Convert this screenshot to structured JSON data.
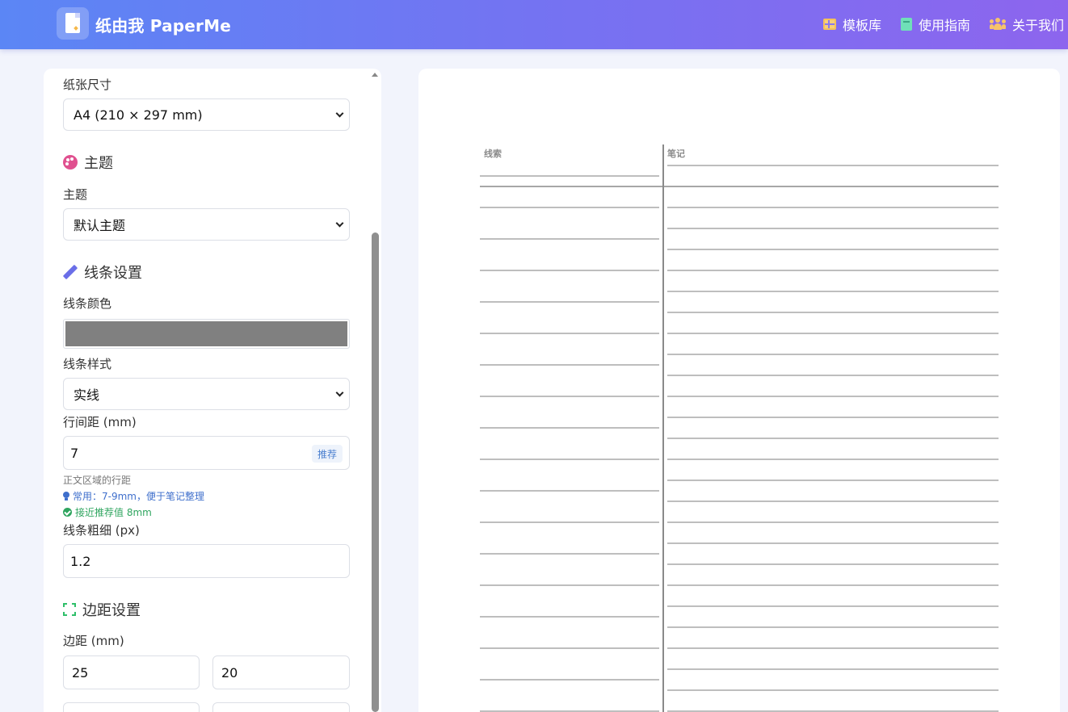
{
  "header": {
    "brand": "纸由我 PaperMe",
    "nav": {
      "templates": "模板库",
      "guide": "使用指南",
      "about": "关于我们"
    }
  },
  "sidebar": {
    "paper_size": {
      "label": "纸张尺寸",
      "value": "A4 (210 × 297 mm)"
    },
    "theme_section": {
      "title": "主题",
      "label": "主题",
      "value": "默认主题"
    },
    "line_section": {
      "title": "线条设置",
      "color_label": "线条颜色",
      "color_value": "#808080",
      "style_label": "线条样式",
      "style_value": "实线",
      "spacing_label": "行间距 (mm)",
      "spacing_value": "7",
      "spacing_badge": "推荐",
      "hint_region": "正文区域的行距",
      "hint_common": "常用：7-9mm，便于笔记整理",
      "hint_near": "接近推荐值 8mm",
      "width_label": "线条粗细 (px)",
      "width_value": "1.2"
    },
    "margin_section": {
      "title": "边距设置",
      "label": "边距 (mm)",
      "values": [
        "25",
        "20"
      ]
    }
  },
  "preview": {
    "cue_column_heading": "线索",
    "notes_column_heading": "笔记",
    "line_color": "#a8a8a8",
    "divider_color": "#8a8a8a"
  }
}
